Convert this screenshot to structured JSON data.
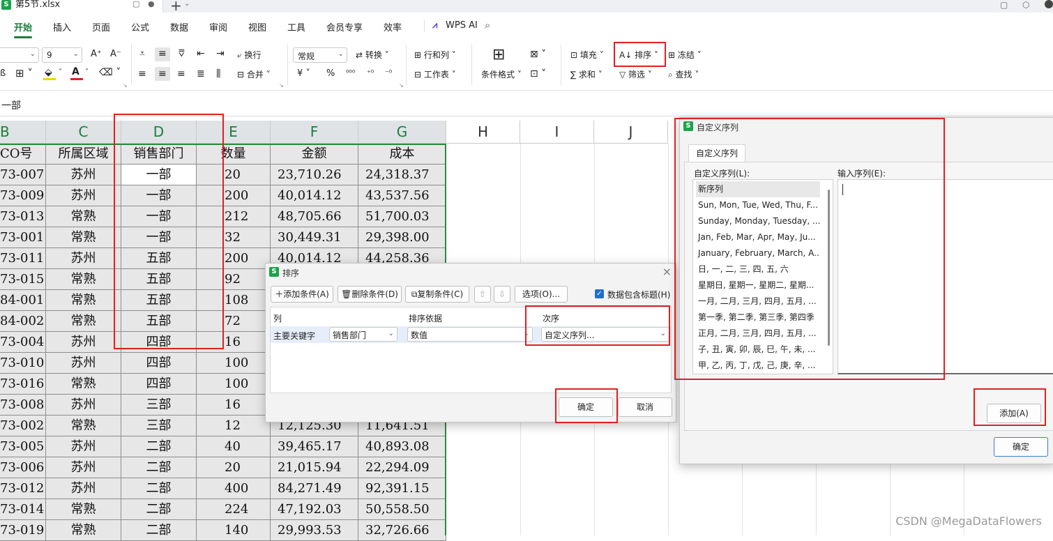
{
  "titlebar": {
    "file_name": "第5节.xlsx",
    "new_tab": "+"
  },
  "menu": {
    "items": [
      "开始",
      "插入",
      "页面",
      "公式",
      "数据",
      "审阅",
      "视图",
      "工具",
      "会员专享",
      "效率"
    ],
    "wps_ai": "WPS AI"
  },
  "ribbon": {
    "font_size": "9",
    "number_format": "常规",
    "wrap": "换行",
    "merge": "合并",
    "convert": "转换",
    "row_col": "行和列",
    "worksheet": "工作表",
    "cond_format": "条件格式",
    "fill": "填充",
    "sort": "排序",
    "freeze": "冻结",
    "sum": "求和",
    "filter": "筛选",
    "find": "查找",
    "currency": "¥",
    "percent": "%"
  },
  "formula": {
    "value": "一部"
  },
  "sheet": {
    "col_headers": [
      "B",
      "C",
      "D",
      "E",
      "F",
      "G",
      "H",
      "I",
      "J"
    ],
    "header_row": [
      "CO号",
      "所属区域",
      "销售部门",
      "数量",
      "金额",
      "成本"
    ],
    "rows": [
      [
        "73-007",
        "苏州",
        "一部",
        "20",
        "23,710.26",
        "24,318.37"
      ],
      [
        "73-009",
        "苏州",
        "一部",
        "200",
        "40,014.12",
        "43,537.56"
      ],
      [
        "73-013",
        "常熟",
        "一部",
        "212",
        "48,705.66",
        "51,700.03"
      ],
      [
        "73-001",
        "常熟",
        "一部",
        "32",
        "30,449.31",
        "29,398.00"
      ],
      [
        "73-011",
        "苏州",
        "五部",
        "200",
        "40,014.12",
        "44,258.36"
      ],
      [
        "73-015",
        "常熟",
        "五部",
        "92",
        "",
        ""
      ],
      [
        "84-001",
        "常熟",
        "五部",
        "108",
        "",
        ""
      ],
      [
        "84-002",
        "常熟",
        "五部",
        "72",
        "",
        ""
      ],
      [
        "73-004",
        "苏州",
        "四部",
        "16",
        "",
        ""
      ],
      [
        "73-010",
        "苏州",
        "四部",
        "100",
        "",
        ""
      ],
      [
        "73-016",
        "常熟",
        "四部",
        "100",
        "",
        ""
      ],
      [
        "73-008",
        "苏州",
        "三部",
        "16",
        "",
        ""
      ],
      [
        "73-002",
        "常熟",
        "三部",
        "12",
        "12,125.30",
        "11,641.51"
      ],
      [
        "73-005",
        "苏州",
        "二部",
        "40",
        "39,465.17",
        "40,893.08"
      ],
      [
        "73-006",
        "苏州",
        "二部",
        "20",
        "21,015.94",
        "22,294.09"
      ],
      [
        "73-012",
        "苏州",
        "二部",
        "400",
        "84,271.49",
        "92,391.15"
      ],
      [
        "73-014",
        "常熟",
        "二部",
        "224",
        "47,192.03",
        "50,558.50"
      ],
      [
        "73-019",
        "常熟",
        "二部",
        "140",
        "29,993.53",
        "32,726.66"
      ]
    ]
  },
  "sort_dialog": {
    "title": "排序",
    "add_condition": "添加条件(A)",
    "delete_condition": "删除条件(D)",
    "copy_condition": "复制条件(C)",
    "options": "选项(O)...",
    "has_header": "数据包含标题(H)",
    "col_header": "列",
    "basis_header": "排序依据",
    "order_header": "次序",
    "key_label": "主要关键字",
    "key_value": "销售部门",
    "basis_value": "数值",
    "order_value": "自定义序列...",
    "ok": "确定",
    "cancel": "取消"
  },
  "custom_dialog": {
    "title": "自定义序列",
    "tab": "自定义序列",
    "list_label": "自定义序列(L):",
    "input_label": "输入序列(E):",
    "items": [
      "新序列",
      "Sun, Mon, Tue, Wed, Thu, F...",
      "Sunday, Monday, Tuesday, ...",
      "Jan, Feb, Mar, Apr, May, Ju...",
      "January, February, March, A...",
      "日, 一, 二, 三, 四, 五, 六",
      "星期日, 星期一, 星期二, 星期...",
      "一月, 二月, 三月, 四月, 五月, ...",
      "第一季, 第二季, 第三季, 第四季",
      "正月, 二月, 三月, 四月, 五月, ...",
      "子, 丑, 寅, 卯, 辰, 巳, 午, 未, ...",
      "甲, 乙, 丙, 丁, 戊, 己, 庚, 辛, ..."
    ],
    "add": "添加(A)",
    "ok": "确定"
  },
  "watermark": "CSDN @MegaDataFlowers"
}
